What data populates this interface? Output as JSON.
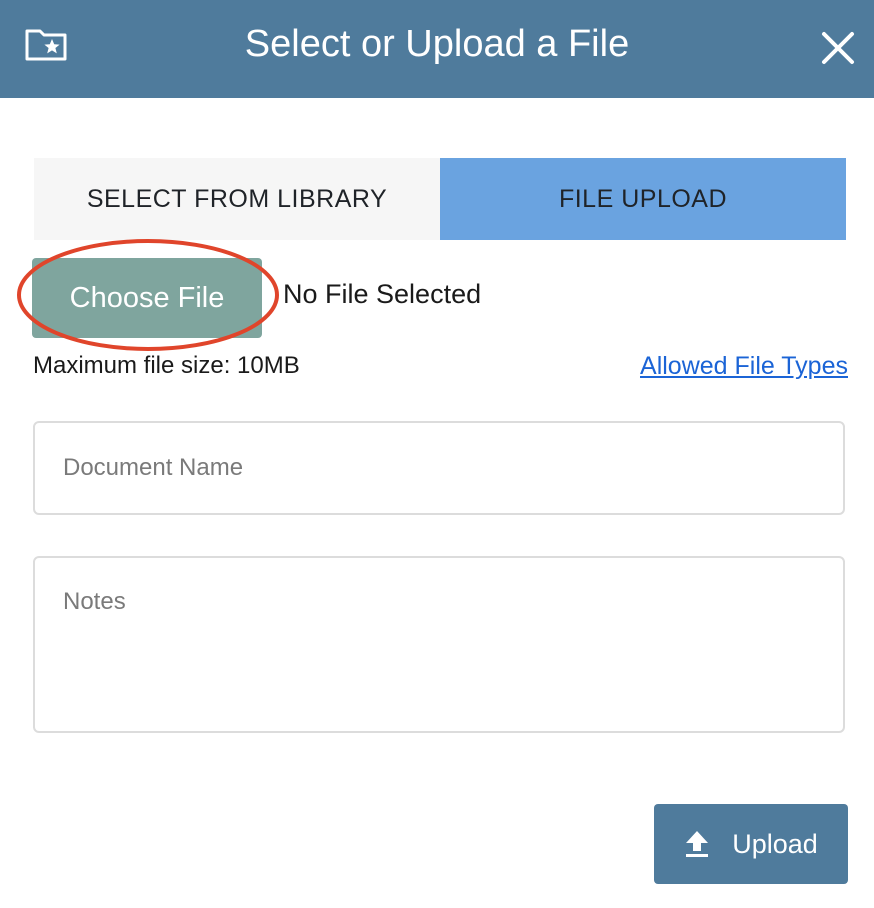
{
  "dialog": {
    "title": "Select or Upload a File",
    "icons": {
      "folder": "folder-star-icon",
      "close": "close-icon",
      "upload": "upload-arrow-icon"
    },
    "colors": {
      "header": "#4f7b9c",
      "active_tab": "#6aa3e0",
      "choose_button": "#7fa59e",
      "link": "#1b64d6",
      "highlight": "#e0452b"
    }
  },
  "tabs": [
    {
      "label": "SELECT FROM LIBRARY",
      "active": false
    },
    {
      "label": "FILE UPLOAD",
      "active": true
    }
  ],
  "file_input": {
    "button_label": "Choose File",
    "status": "No File Selected"
  },
  "info": {
    "max_size": "Maximum file size: 10MB",
    "allowed_types_link": "Allowed File Types"
  },
  "form": {
    "document_name_placeholder": "Document Name",
    "notes_placeholder": "Notes"
  },
  "actions": {
    "upload_label": "Upload"
  }
}
